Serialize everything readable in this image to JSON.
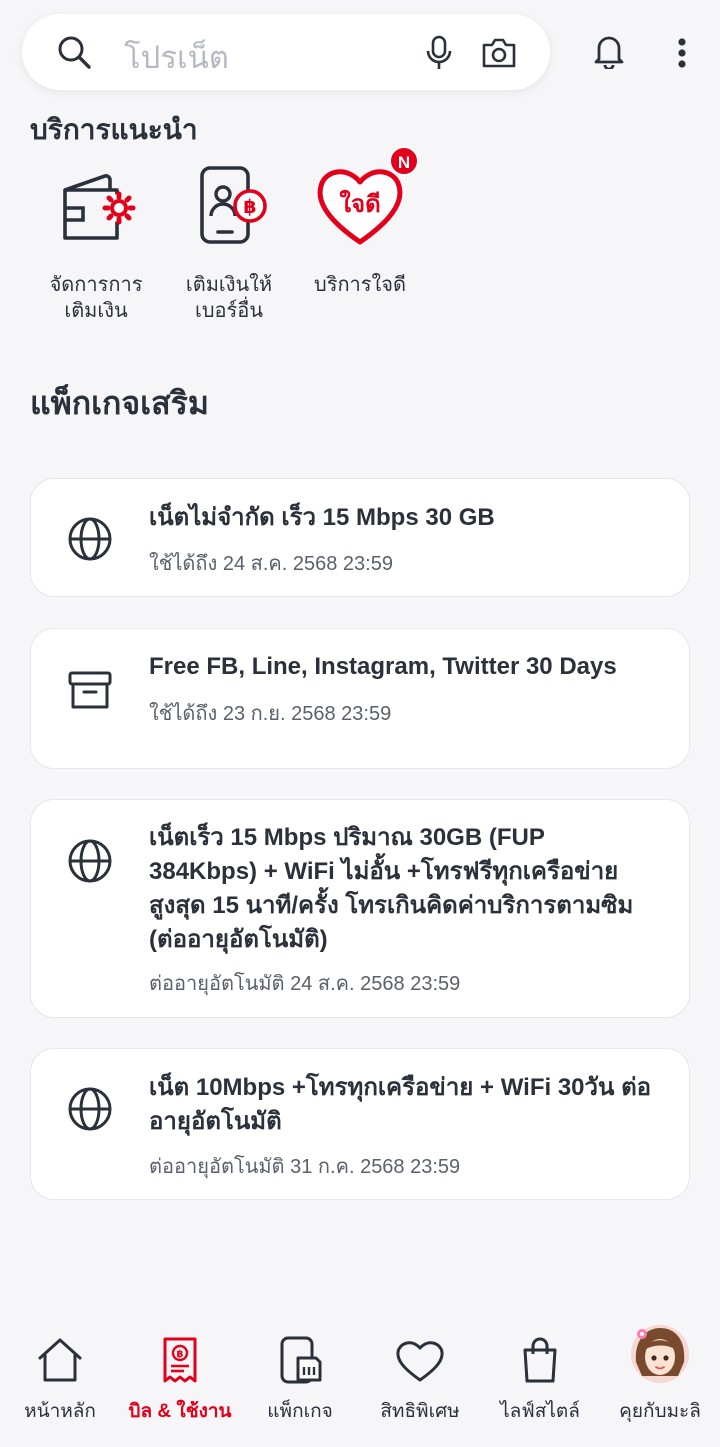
{
  "search": {
    "placeholder": "โปรเน็ต"
  },
  "recommended": {
    "title": "บริการแนะนำ",
    "items": [
      {
        "label": "จัดการการ\nเติมเงิน",
        "icon": "wallet-gear-icon"
      },
      {
        "label": "เติมเงินให้\nเบอร์อื่น",
        "icon": "phone-baht-icon"
      },
      {
        "label": "บริการใจดี",
        "icon": "jaidee-heart-icon",
        "logo_text": "ใจดี",
        "badge": "N"
      }
    ]
  },
  "addon": {
    "title": "แพ็กเกจเสริม",
    "cards": [
      {
        "icon": "globe-icon",
        "title": "เน็ตไม่จำกัด เร็ว 15 Mbps 30 GB",
        "sub": "ใช้ได้ถึง 24 ส.ค. 2568 23:59"
      },
      {
        "icon": "archive-box-icon",
        "title": "Free FB, Line, Instagram, Twitter 30 Days",
        "sub": "ใช้ได้ถึง 23 ก.ย. 2568 23:59"
      },
      {
        "icon": "globe-icon",
        "title": "เน็ตเร็ว 15 Mbps ปริมาณ 30GB (FUP 384Kbps) + WiFi ไม่อั้น +โทรฟรีทุกเครือข่าย สูงสุด 15 นาที/ครั้ง โทรเกินคิดค่าบริการตามซิม (ต่ออายุอัตโนมัติ)",
        "sub": "ต่ออายุอัตโนมัติ 24 ส.ค. 2568 23:59"
      },
      {
        "icon": "globe-icon",
        "title": "เน็ต 10Mbps +โทรทุกเครือข่าย + WiFi 30วัน ต่ออายุอัตโนมัติ",
        "sub": "ต่ออายุอัตโนมัติ 31 ก.ค. 2568 23:59"
      }
    ]
  },
  "bottom_nav": {
    "items": [
      {
        "label": "หน้าหลัก",
        "icon": "home-icon",
        "active": false
      },
      {
        "label": "บิล & ใช้งาน",
        "icon": "bill-receipt-icon",
        "active": true
      },
      {
        "label": "แพ็กเกจ",
        "icon": "sim-phone-icon",
        "active": false
      },
      {
        "label": "สิทธิพิเศษ",
        "icon": "heart-icon",
        "active": false
      },
      {
        "label": "ไลฟ์สไตล์",
        "icon": "shopping-bag-icon",
        "active": false
      },
      {
        "label": "คุยกับมะลิ",
        "icon": "mali-avatar-icon",
        "active": false
      }
    ]
  },
  "colors": {
    "accent": "#e2001a",
    "text": "#2b313b",
    "background": "#f6f6f9"
  }
}
